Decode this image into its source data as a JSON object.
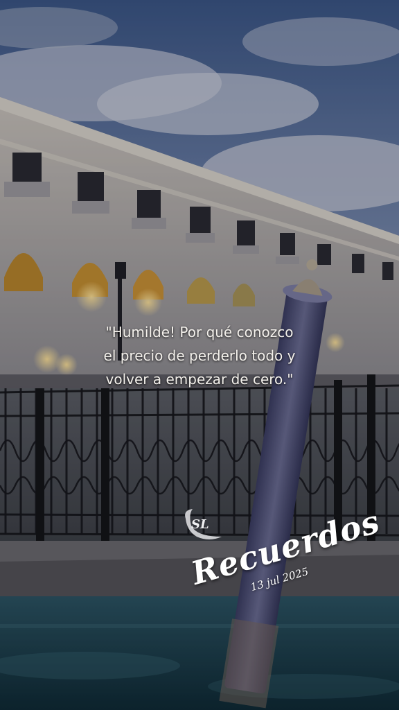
{
  "quote": {
    "line1": "\"Humilde! Por qué conozco",
    "line2": "el precio de perderlo todo y",
    "line3": "volver a empezar de cero.\""
  },
  "brand": {
    "name": "Recuerdos",
    "date": "13 jul 2025"
  },
  "colors": {
    "sky_top": "#3d5a8c",
    "building": "#b9b3ad",
    "window_glow": "#d9a23a",
    "water": "#1f4a5a",
    "text": "#f4f1ec"
  }
}
